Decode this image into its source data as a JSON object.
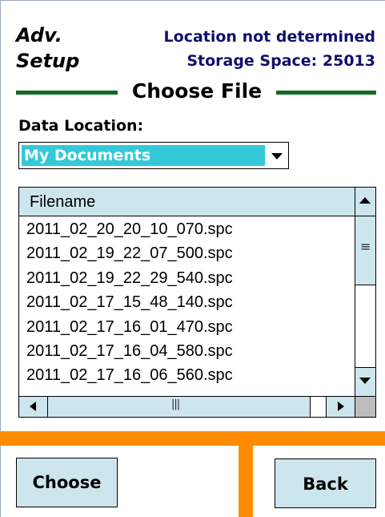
{
  "header": {
    "title_line1": "Adv.",
    "title_line2": "Setup",
    "status_line1": "Location not determined",
    "status_line2": "Storage Space: 25013"
  },
  "section_title": "Choose File",
  "data_location": {
    "label": "Data Location:",
    "selected": "My Documents"
  },
  "file_list": {
    "column_header": "Filename",
    "files": [
      "2011_02_20_20_10_070.spc",
      "2011_02_19_22_07_500.spc",
      "2011_02_19_22_29_540.spc",
      "2011_02_17_15_48_140.spc",
      "2011_02_17_16_01_470.spc",
      "2011_02_17_16_04_580.spc",
      "2011_02_17_16_06_560.spc"
    ]
  },
  "buttons": {
    "choose": "Choose",
    "back": "Back"
  },
  "colors": {
    "title_line": "#106b21",
    "status_text": "#10106b",
    "selection": "#33c9d9",
    "control_fill": "#cde6ee",
    "divider": "#ff8c00"
  }
}
